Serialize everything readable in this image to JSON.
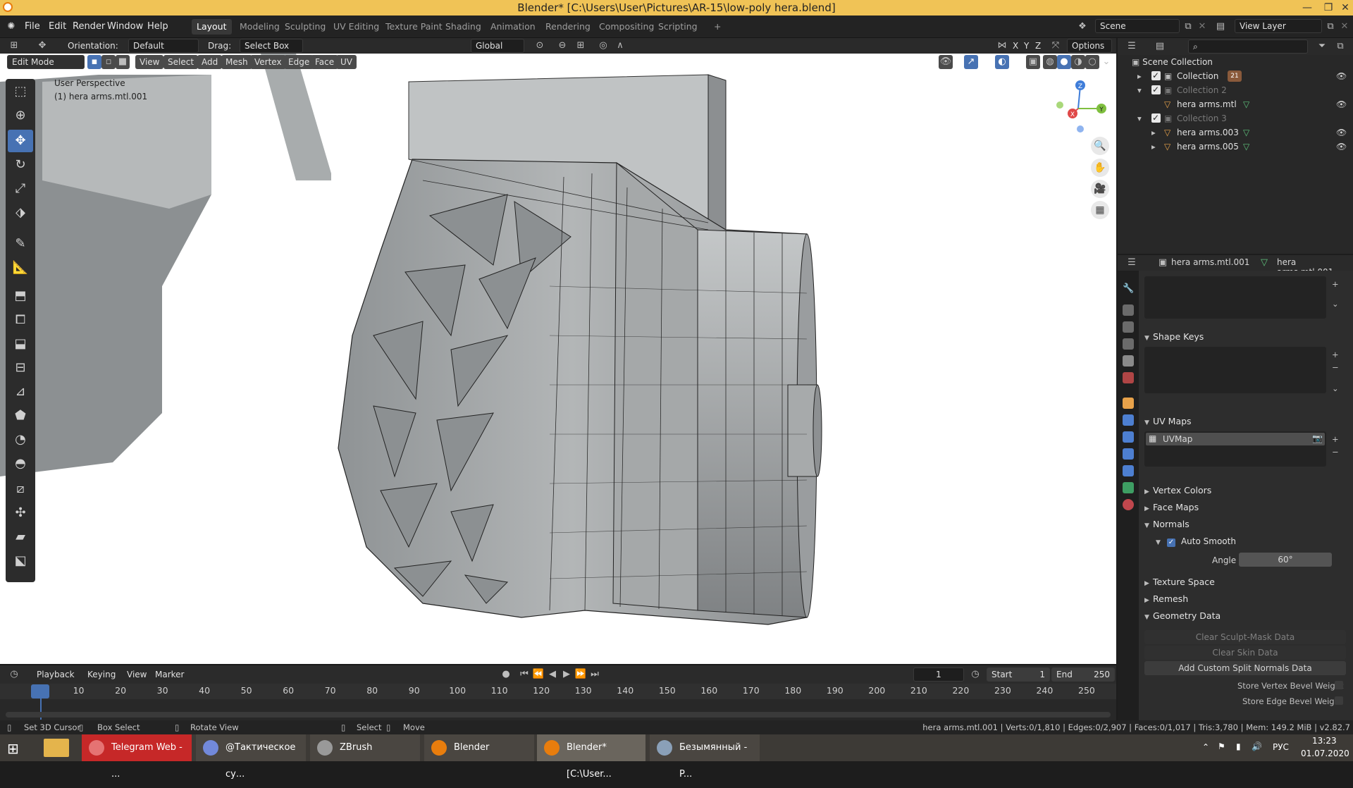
{
  "window": {
    "title": "Blender* [C:\\Users\\User\\Pictures\\AR-15\\low-poly hera.blend]",
    "minimize": "—",
    "maximize": "❐",
    "close": "✕"
  },
  "menu": [
    "File",
    "Edit",
    "Render",
    "Window",
    "Help"
  ],
  "workspaces": [
    {
      "label": "Layout",
      "active": true
    },
    {
      "label": "Modeling"
    },
    {
      "label": "Sculpting"
    },
    {
      "label": "UV Editing"
    },
    {
      "label": "Texture Paint"
    },
    {
      "label": "Shading"
    },
    {
      "label": "Animation"
    },
    {
      "label": "Rendering"
    },
    {
      "label": "Compositing"
    },
    {
      "label": "Scripting"
    },
    {
      "label": "+"
    }
  ],
  "scene": {
    "name": "Scene",
    "view_layer": "View Layer"
  },
  "tool_header": {
    "orientation_label": "Orientation:",
    "orientation_value": "Default",
    "drag_label": "Drag:",
    "drag_value": "Select Box",
    "transform_orientation": "Global",
    "options_label": "Options",
    "axes": [
      "X",
      "Y",
      "Z"
    ]
  },
  "viewport_header": {
    "mode": "Edit Mode",
    "menus": [
      "View",
      "Select",
      "Add",
      "Mesh",
      "Vertex",
      "Edge",
      "Face",
      "UV"
    ]
  },
  "viewport": {
    "perspective": "User Perspective",
    "object": "(1) hera arms.mtl.001",
    "gizmo": {
      "z": "Z",
      "x": "X",
      "y": "Y"
    }
  },
  "outliner": {
    "root": "Scene Collection",
    "rows": [
      {
        "label": "Collection",
        "level": 1,
        "checked": true,
        "badge": "21"
      },
      {
        "label": "Collection 2",
        "level": 1,
        "checked": true,
        "dim": true
      },
      {
        "label": "hera arms.mtl",
        "level": 2
      },
      {
        "label": "Collection 3",
        "level": 1,
        "checked": true,
        "dim": true
      },
      {
        "label": "hera arms.003",
        "level": 2
      },
      {
        "label": "hera arms.005",
        "level": 2
      }
    ]
  },
  "properties": {
    "object_name": "hera arms.mtl.001",
    "mesh_name": "hera arms.mtl.001",
    "sections": {
      "shape_keys": "Shape Keys",
      "uv_maps": "UV Maps",
      "vertex_colors": "Vertex Colors",
      "face_maps": "Face Maps",
      "normals": "Normals",
      "auto_smooth": "Auto Smooth",
      "angle_label": "Angle",
      "angle_value": "60°",
      "texture_space": "Texture Space",
      "remesh": "Remesh",
      "geometry_data": "Geometry Data"
    },
    "uv_map_item": "UVMap",
    "buttons": {
      "clear_sculpt_mask": "Clear Sculpt-Mask Data",
      "clear_skin": "Clear Skin Data",
      "add_split_normals": "Add Custom Split Normals Data"
    },
    "store_vertex_bevel": "Store Vertex Bevel Weight",
    "store_edge_bevel": "Store Edge Bevel Weight"
  },
  "timeline": {
    "menus": [
      "Playback",
      "Keying",
      "View",
      "Marker"
    ],
    "current_frame": "1",
    "start_label": "Start",
    "start": "1",
    "end_label": "End",
    "end": "250",
    "ruler": [
      "1",
      "10",
      "20",
      "30",
      "40",
      "50",
      "60",
      "70",
      "80",
      "90",
      "100",
      "110",
      "120",
      "130",
      "140",
      "150",
      "160",
      "170",
      "180",
      "190",
      "200",
      "210",
      "220",
      "230",
      "240",
      "250"
    ]
  },
  "statusbar": {
    "items": [
      "Set 3D Cursor",
      "Box Select",
      "Rotate View",
      "Select",
      "Move"
    ],
    "stats": "hera arms.mtl.001 | Verts:0/1,810 | Edges:0/2,907 | Faces:0/1,017 | Tris:3,780 | Mem: 149.2 MiB | v2.82.7"
  },
  "taskbar": {
    "items": [
      {
        "label": "Telegram Web - ...",
        "color": "#c62828"
      },
      {
        "label": "@Тактическое су...",
        "color": "#7289da"
      },
      {
        "label": "ZBrush",
        "color": "#555555"
      },
      {
        "label": "Blender",
        "color": "#e87d0d"
      },
      {
        "label": "Blender* [C:\\User...",
        "color": "#e87d0d"
      },
      {
        "label": "Безымянный - P...",
        "color": "#8aa0b8"
      }
    ],
    "lang": "РУС",
    "time": "13:23",
    "date": "01.07.2020"
  },
  "colors": {
    "accent": "#4772b3",
    "titlebar": "#f0c356",
    "mesh": "#9da1a3"
  }
}
